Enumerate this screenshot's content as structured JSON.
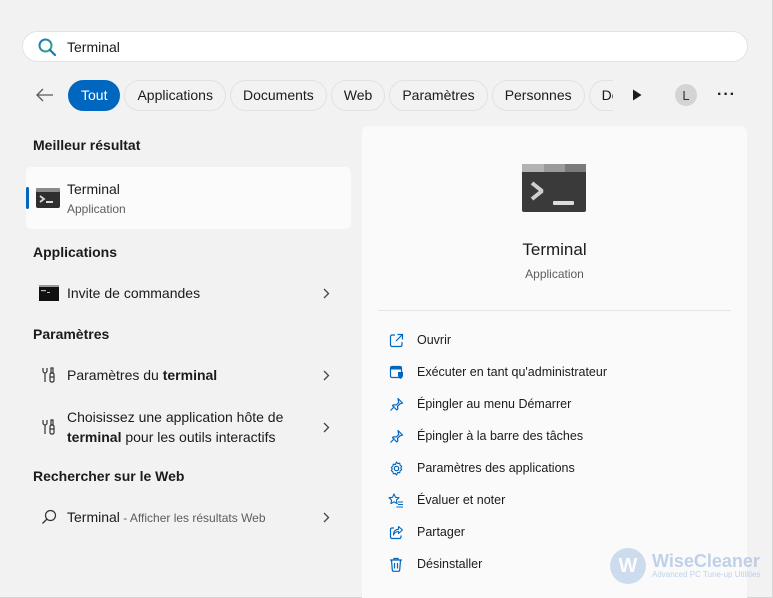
{
  "search": {
    "value": "Terminal",
    "accent": "#0067c0"
  },
  "filters": {
    "back_icon": "arrow-left-icon",
    "chips": [
      {
        "label": "Tout",
        "active": true
      },
      {
        "label": "Applications",
        "active": false
      },
      {
        "label": "Documents",
        "active": false
      },
      {
        "label": "Web",
        "active": false
      },
      {
        "label": "Paramètres",
        "active": false
      },
      {
        "label": "Personnes",
        "active": false
      },
      {
        "label": "Dos",
        "active": false
      }
    ],
    "more_icon": "play-arrow-icon",
    "avatar_initial": "L",
    "overflow_label": "···"
  },
  "left": {
    "best_title": "Meilleur résultat",
    "best": {
      "name": "Terminal",
      "type": "Application"
    },
    "apps_title": "Applications",
    "apps": [
      {
        "label": "Invite de commandes"
      }
    ],
    "settings_title": "Paramètres",
    "settings": [
      {
        "pre": "Paramètres du ",
        "bold": "terminal",
        "post": ""
      },
      {
        "line1": "Choisissez une application hôte de",
        "bold": "terminal",
        "post": " pour les outils interactifs"
      }
    ],
    "web_title": "Rechercher sur le Web",
    "web": {
      "term": "Terminal",
      "suffix": " - Afficher les résultats Web"
    }
  },
  "right": {
    "name": "Terminal",
    "type": "Application",
    "actions": [
      {
        "label": "Ouvrir",
        "icon": "open-external-icon"
      },
      {
        "label": "Exécuter en tant qu'administrateur",
        "icon": "run-as-admin-icon"
      },
      {
        "label": "Épingler au menu Démarrer",
        "icon": "pin-icon"
      },
      {
        "label": "Épingler à la barre des tâches",
        "icon": "pin-icon"
      },
      {
        "label": "Paramètres des applications",
        "icon": "gear-icon"
      },
      {
        "label": "Évaluer et noter",
        "icon": "star-rate-icon"
      },
      {
        "label": "Partager",
        "icon": "share-icon"
      },
      {
        "label": "Désinstaller",
        "icon": "trash-icon"
      }
    ]
  },
  "watermark": {
    "letter": "W",
    "name": "WiseCleaner",
    "tagline": "Advanced PC Tune-up Utilities"
  }
}
